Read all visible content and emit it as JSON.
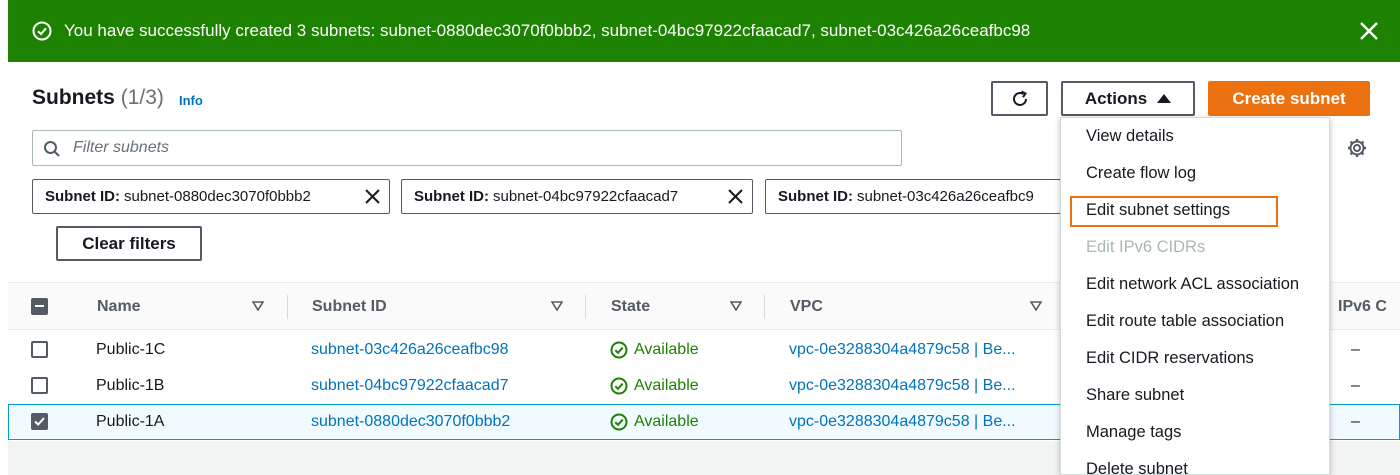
{
  "flash": {
    "message": "You have successfully created 3 subnets: subnet-0880dec3070f0bbb2, subnet-04bc97922cfaacad7, subnet-03c426a26ceafbc98",
    "icon": "check-circle-icon",
    "color": "#1d8102"
  },
  "header": {
    "title": "Subnets",
    "count": "(1/3)",
    "info": "Info",
    "actions_label": "Actions",
    "create_label": "Create subnet"
  },
  "search": {
    "placeholder": "Filter subnets"
  },
  "filters": [
    {
      "key": "Subnet ID:",
      "value": "subnet-0880dec3070f0bbb2"
    },
    {
      "key": "Subnet ID:",
      "value": "subnet-04bc97922cfaacad7"
    },
    {
      "key": "Subnet ID:",
      "value": "subnet-03c426a26ceafbc9"
    }
  ],
  "clear_filters": "Clear filters",
  "table": {
    "columns": [
      "Name",
      "Subnet ID",
      "State",
      "VPC",
      "IPv6 C"
    ],
    "rows": [
      {
        "name": "Public-1C",
        "subnet_id": "subnet-03c426a26ceafbc98",
        "state": "Available",
        "vpc": "vpc-0e3288304a4879c58 | Be...",
        "ipv6": "–",
        "checked": false
      },
      {
        "name": "Public-1B",
        "subnet_id": "subnet-04bc97922cfaacad7",
        "state": "Available",
        "vpc": "vpc-0e3288304a4879c58 | Be...",
        "ipv6": "–",
        "checked": false
      },
      {
        "name": "Public-1A",
        "subnet_id": "subnet-0880dec3070f0bbb2",
        "state": "Available",
        "vpc": "vpc-0e3288304a4879c58 | Be...",
        "ipv6": "–",
        "checked": true
      }
    ]
  },
  "menu": {
    "items": [
      {
        "label": "View details",
        "disabled": false
      },
      {
        "label": "Create flow log",
        "disabled": false
      },
      {
        "label": "Edit subnet settings",
        "disabled": false,
        "highlighted": true
      },
      {
        "label": "Edit IPv6 CIDRs",
        "disabled": true
      },
      {
        "label": "Edit network ACL association",
        "disabled": false
      },
      {
        "label": "Edit route table association",
        "disabled": false
      },
      {
        "label": "Edit CIDR reservations",
        "disabled": false
      },
      {
        "label": "Share subnet",
        "disabled": false
      },
      {
        "label": "Manage tags",
        "disabled": false
      },
      {
        "label": "Delete subnet",
        "disabled": false
      }
    ]
  },
  "colors": {
    "primary": "#ec7211",
    "link": "#0073bb",
    "success": "#1d8102",
    "highlight_border": "#ec7211"
  }
}
